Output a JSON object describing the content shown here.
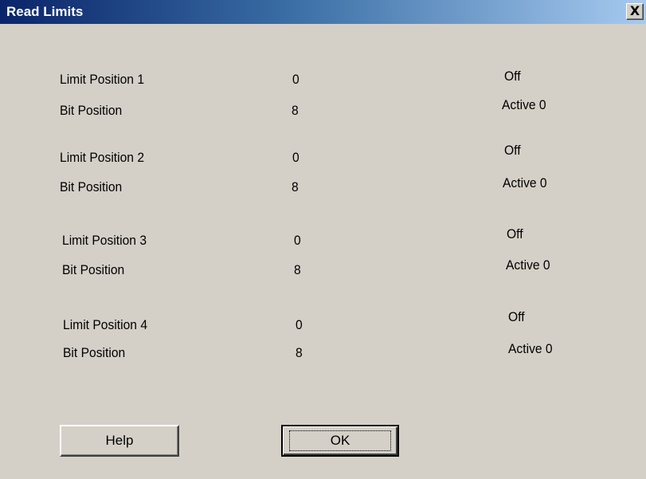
{
  "window": {
    "title": "Read Limits",
    "close_glyph": "X"
  },
  "groups": [
    {
      "limit_label": "Limit Position 1",
      "limit_value": "0",
      "state": "Off",
      "bit_label": "Bit Position",
      "bit_value": "8",
      "active": "Active 0"
    },
    {
      "limit_label": "Limit Position 2",
      "limit_value": "0",
      "state": "Off",
      "bit_label": "Bit Position",
      "bit_value": "8",
      "active": "Active 0"
    },
    {
      "limit_label": "Limit Position 3",
      "limit_value": "0",
      "state": "Off",
      "bit_label": "Bit Position",
      "bit_value": "8",
      "active": "Active 0"
    },
    {
      "limit_label": "Limit Position 4",
      "limit_value": "0",
      "state": "Off",
      "bit_label": "Bit Position",
      "bit_value": "8",
      "active": "Active 0"
    }
  ],
  "buttons": {
    "help_label": "Help",
    "ok_label": "OK"
  },
  "colors": {
    "face": "#d4d0c8",
    "title_start": "#0a246a",
    "title_end": "#a6caf0"
  }
}
